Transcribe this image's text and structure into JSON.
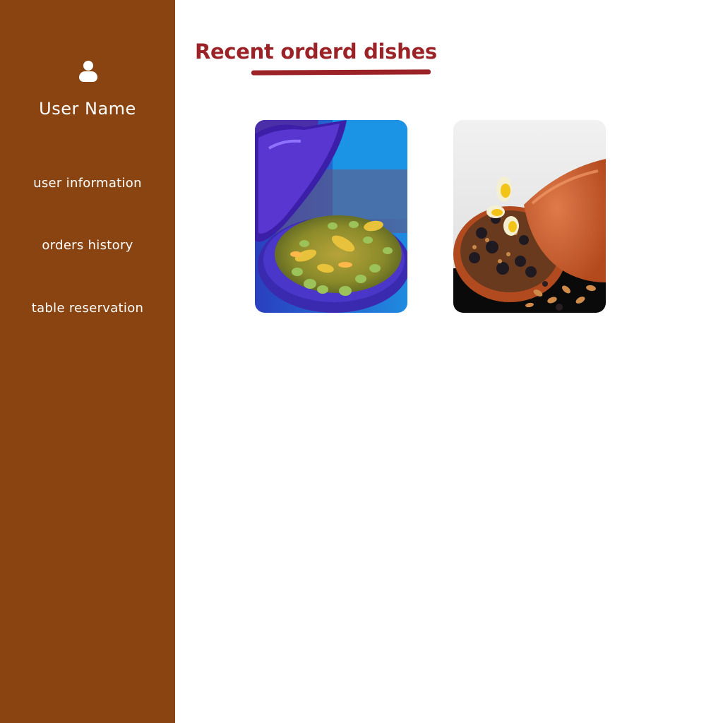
{
  "sidebar": {
    "avatar_icon": "user-icon",
    "user_name": "User Name",
    "items": [
      {
        "label": "user information"
      },
      {
        "label": "orders history"
      },
      {
        "label": "table reservation"
      }
    ]
  },
  "main": {
    "title": "Recent orderd dishes",
    "dishes": [
      {
        "image": "tagine-with-olives-and-preserved-lemon"
      },
      {
        "image": "tagine-with-prunes-eggs-and-almonds"
      }
    ]
  },
  "colors": {
    "sidebar_bg": "#8a4411",
    "title": "#9b2226",
    "text_on_sidebar": "#ffffff"
  }
}
